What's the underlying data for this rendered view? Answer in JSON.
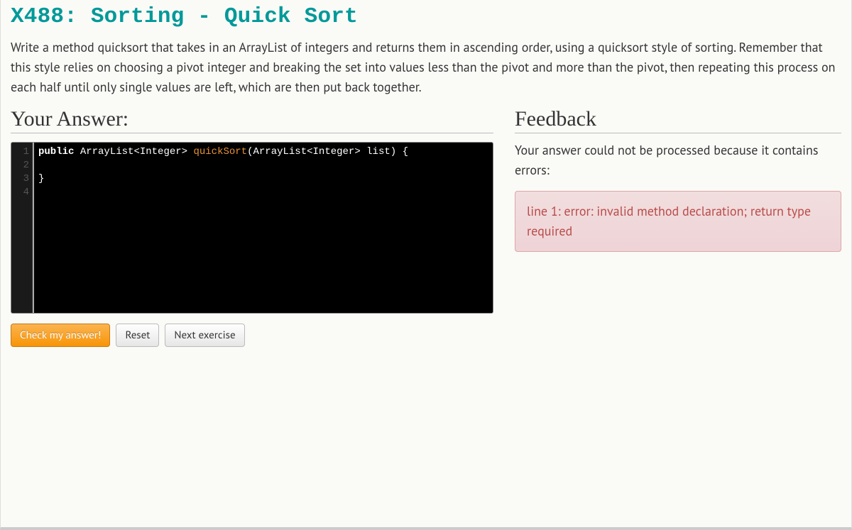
{
  "title": "X488: Sorting - Quick Sort",
  "description": "Write a method quicksort that takes in an ArrayList of integers and returns them in ascending order, using a quicksort style of sorting. Remember that this style relies on choosing a pivot integer and breaking the set into values less than the pivot and more than the pivot, then repeating this process on each half until only single values are left, which are then put back together.",
  "answer_heading": "Your Answer:",
  "feedback_heading": "Feedback",
  "code": {
    "line_numbers": [
      "1",
      "2",
      "3",
      "4"
    ],
    "tokens": {
      "kw_public": "public",
      "type1": "ArrayList<Integer>",
      "method": "quickSort",
      "open_paren": "(",
      "param_type": "ArrayList<Integer>",
      "param_name": "list",
      "close_paren": ")",
      "open_brace": "{",
      "close_brace": "}"
    }
  },
  "buttons": {
    "check": "Check my answer!",
    "reset": "Reset",
    "next": "Next exercise"
  },
  "feedback": {
    "intro": "Your answer could not be processed because it contains errors:",
    "error": "line 1: error: invalid method declaration; return type required"
  }
}
